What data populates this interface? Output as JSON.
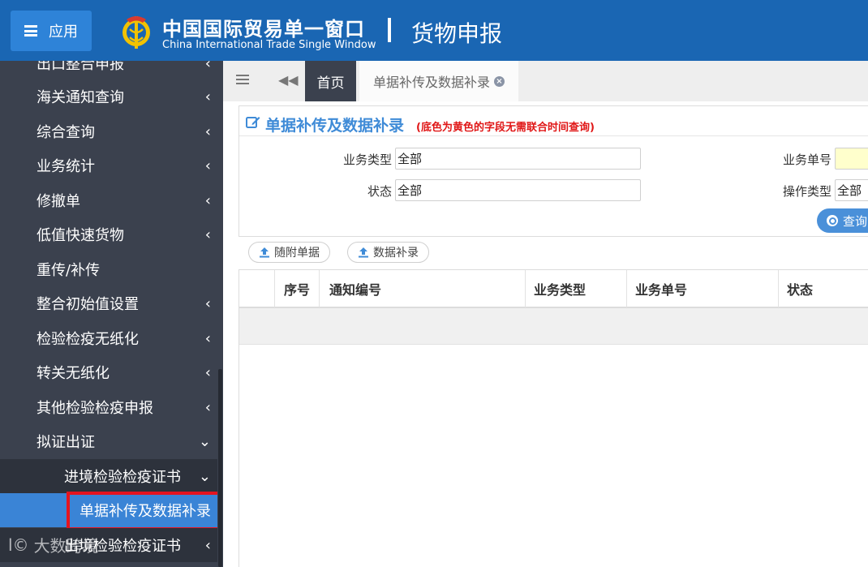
{
  "header": {
    "app_button": "应用",
    "brand_cn": "中国国际贸易单一窗口",
    "brand_en": "China International Trade Single Window",
    "brand_sub": "货物申报",
    "bg_color": "#1a66b3"
  },
  "sidebar": {
    "items": [
      {
        "label": "出口整合申报",
        "chevron": "‹"
      },
      {
        "label": "海关通知查询",
        "chevron": "‹"
      },
      {
        "label": "综合查询",
        "chevron": "‹"
      },
      {
        "label": "业务统计",
        "chevron": "‹"
      },
      {
        "label": "修撤单",
        "chevron": "‹"
      },
      {
        "label": "低值快速货物",
        "chevron": "‹"
      },
      {
        "label": "重传/补传",
        "chevron": ""
      },
      {
        "label": "整合初始值设置",
        "chevron": "‹"
      },
      {
        "label": "检验检疫无纸化",
        "chevron": "‹"
      },
      {
        "label": "转关无纸化",
        "chevron": "‹"
      },
      {
        "label": "其他检验检疫申报",
        "chevron": "‹"
      },
      {
        "label": "拟证出证",
        "chevron": "⌄"
      }
    ],
    "sub_item": {
      "label": "进境检验检疫证书",
      "chevron": "⌄"
    },
    "active_item": {
      "label": "单据补传及数据补录"
    },
    "next_sub_item": {
      "label": "出境检验检疫证书",
      "chevron": "‹"
    },
    "watermark": "大数跨境"
  },
  "tabs": {
    "home": "首页",
    "active": "单据补传及数据补录",
    "close": "×"
  },
  "panel": {
    "title": "单据补传及数据补录",
    "note": "(底色为黄色的字段无需联合时间查询)",
    "fields": {
      "biz_type_label": "业务类型",
      "biz_type_value": "全部",
      "status_label": "状态",
      "status_value": "全部",
      "biz_no_label": "业务单号",
      "biz_no_value": "",
      "op_type_label": "操作类型",
      "op_type_value": "全部"
    },
    "query_button": "查询"
  },
  "actions": {
    "attach_docs": "随附单据",
    "data_entry": "数据补录"
  },
  "table": {
    "columns": [
      "序号",
      "通知编号",
      "业务类型",
      "业务单号",
      "状态"
    ],
    "rows": []
  }
}
